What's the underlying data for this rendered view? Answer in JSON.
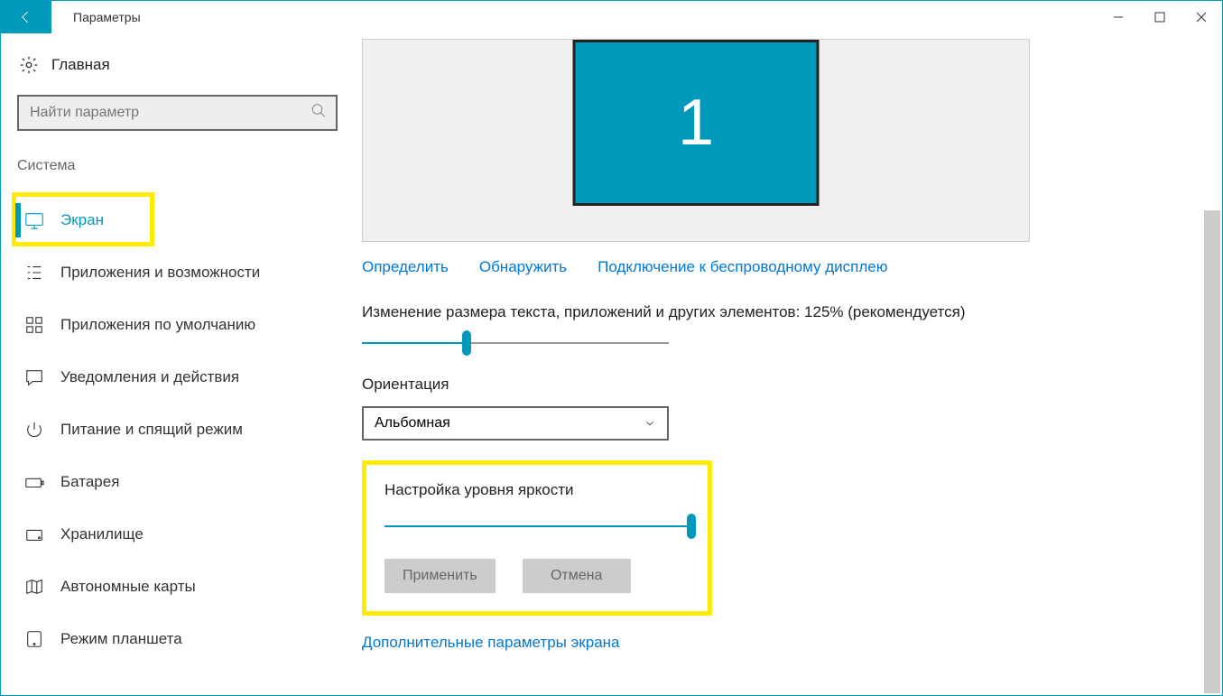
{
  "titlebar": {
    "title": "Параметры"
  },
  "sidebar": {
    "home": "Главная",
    "search_placeholder": "Найти параметр",
    "section": "Система",
    "items": [
      {
        "key": "display",
        "label": "Экран",
        "active": true
      },
      {
        "key": "apps",
        "label": "Приложения и возможности"
      },
      {
        "key": "default-apps",
        "label": "Приложения по умолчанию"
      },
      {
        "key": "notifications",
        "label": "Уведомления и действия"
      },
      {
        "key": "power",
        "label": "Питание и спящий режим"
      },
      {
        "key": "battery",
        "label": "Батарея"
      },
      {
        "key": "storage",
        "label": "Хранилище"
      },
      {
        "key": "maps",
        "label": "Автономные карты"
      },
      {
        "key": "tablet",
        "label": "Режим планшета"
      }
    ]
  },
  "main": {
    "monitor_number": "1",
    "links": {
      "identify": "Определить",
      "detect": "Обнаружить",
      "wireless": "Подключение к беспроводному дисплею"
    },
    "scale_label": "Изменение размера текста, приложений и других элементов: 125% (рекомендуется)",
    "scale_slider_percent": 34,
    "orientation_label": "Ориентация",
    "orientation_value": "Альбомная",
    "brightness_label": "Настройка уровня яркости",
    "brightness_percent": 100,
    "apply_btn": "Применить",
    "cancel_btn": "Отмена",
    "advanced_link": "Дополнительные параметры экрана"
  }
}
